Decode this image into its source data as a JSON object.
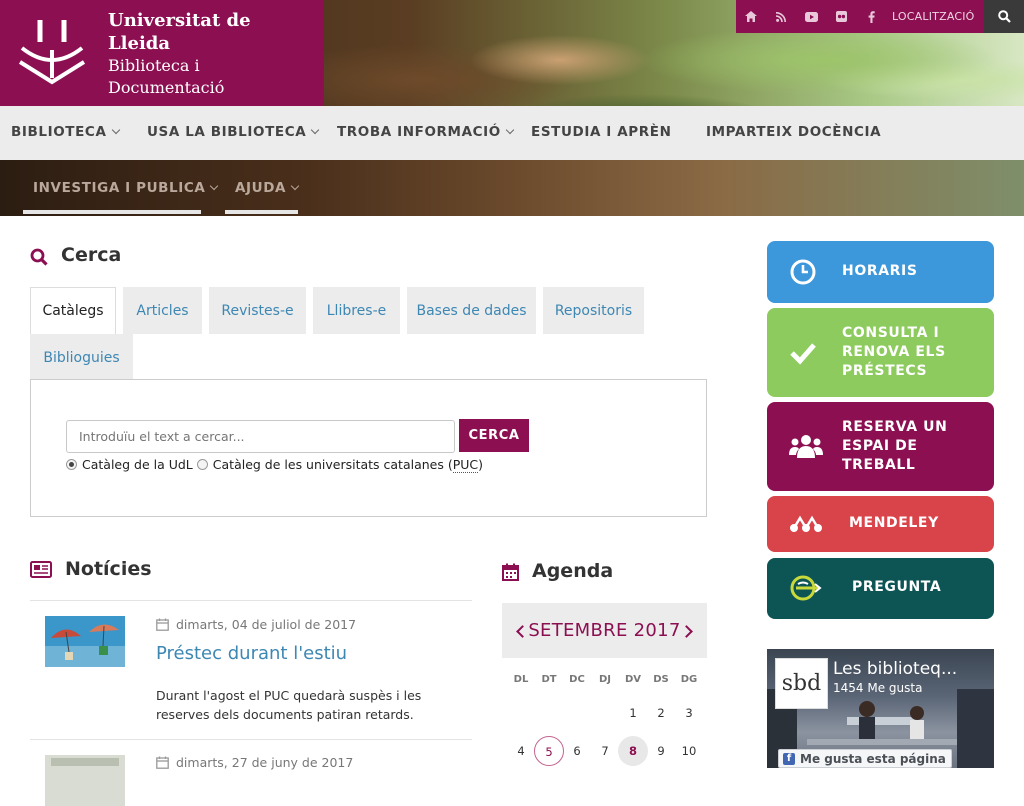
{
  "header": {
    "title": "Universitat de Lleida",
    "subtitle": "Biblioteca i Documentació",
    "topbar": {
      "icons": [
        "home-icon",
        "rss-icon",
        "youtube-icon",
        "flickr-icon",
        "facebook-icon"
      ],
      "location_label": "LOCALITZACIÓ",
      "search_icon": "search-icon"
    }
  },
  "nav": {
    "items": [
      {
        "label": "BIBLIOTECA",
        "has_dropdown": true
      },
      {
        "label": "USA LA BIBLIOTECA",
        "has_dropdown": true
      },
      {
        "label": "TROBA INFORMACIÓ",
        "has_dropdown": true
      },
      {
        "label": "ESTUDIA I APRÈN",
        "has_dropdown": false
      },
      {
        "label": "IMPARTEIX DOCÈNCIA",
        "has_dropdown": false
      },
      {
        "label": "INVESTIGA I PUBLICA",
        "has_dropdown": true
      },
      {
        "label": "AJUDA",
        "has_dropdown": true
      }
    ]
  },
  "search": {
    "title": "Cerca",
    "tabs": [
      "Catàlegs",
      "Articles",
      "Revistes-e",
      "Llibres-e",
      "Bases de dades",
      "Repositoris",
      "Biblioguies"
    ],
    "active_tab": "Catàlegs",
    "input_placeholder": "Introduïu el text a cercar...",
    "button_label": "CERCA",
    "options": [
      {
        "label": "Catàleg de la UdL",
        "selected": true
      },
      {
        "label_prefix": "Catàleg de les universitats catalanes (",
        "abbr": "PUC",
        "label_suffix": ")",
        "selected": false
      }
    ]
  },
  "news": {
    "title": "Notícies",
    "items": [
      {
        "date": "dimarts, 04 de juliol de 2017",
        "title": "Préstec durant l'estiu",
        "text": "Durant l'agost el PUC quedarà suspès i les reserves dels documents patiran retards."
      },
      {
        "date": "dimarts, 27 de juny de 2017",
        "title": "",
        "text": ""
      }
    ]
  },
  "agenda": {
    "title": "Agenda",
    "month": "SETEMBRE 2017",
    "weekdays": [
      "DL",
      "DT",
      "DC",
      "DJ",
      "DV",
      "DS",
      "DG"
    ],
    "row1": [
      "",
      "",
      "",
      "",
      "1",
      "2",
      "3"
    ],
    "row2": [
      "4",
      "5",
      "6",
      "7",
      "8",
      "9",
      "10"
    ],
    "ringed_day": "5",
    "highlighted_day": "8"
  },
  "sidebar": {
    "buttons": [
      {
        "label": "HORARIS",
        "icon": "clock-icon",
        "color": "#3d97db"
      },
      {
        "label": "CONSULTA I RENOVA ELS PRÉSTECS",
        "icon": "check-icon",
        "color": "#8dcb5e"
      },
      {
        "label": "RESERVA UN ESPAI DE TREBALL",
        "icon": "users-icon",
        "color": "#8c0f52"
      },
      {
        "label": "MENDELEY",
        "icon": "mendeley-icon",
        "color": "#d9434a"
      },
      {
        "label": "PREGUNTA",
        "icon": "question-service-icon",
        "color": "#0d5555"
      }
    ]
  },
  "facebook": {
    "logo_text": "sbd",
    "page_name": "Les biblioteq...",
    "likes": "1454 Me gusta",
    "like_button": "Me gusta esta página"
  },
  "colors": {
    "brand": "#8c0f52",
    "link": "#3d87b3",
    "nav_bg": "#ececec"
  }
}
